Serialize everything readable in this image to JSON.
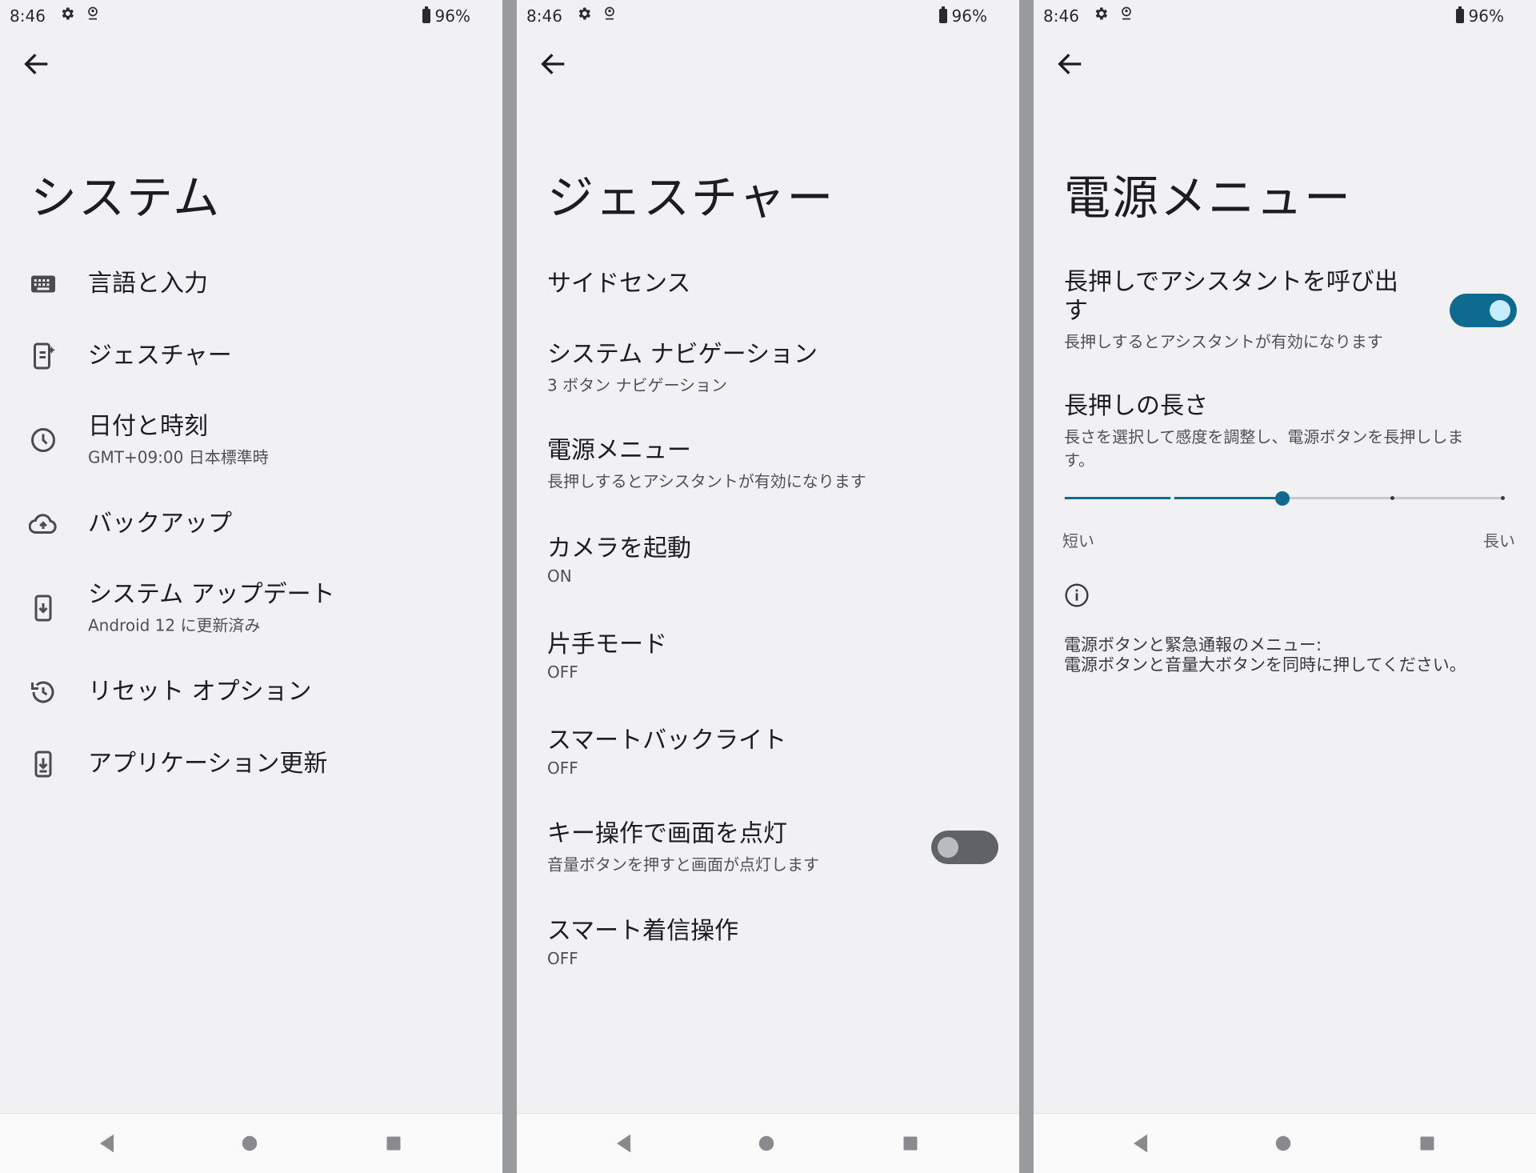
{
  "statusbar": {
    "time": "8:46",
    "battery": "96%"
  },
  "colors": {
    "accent": "#0f6a8f",
    "background": "#f1f0f3",
    "toggle_off": "#5f6266"
  },
  "screen1": {
    "title": "システム",
    "items": [
      {
        "icon": "keyboard-icon",
        "title": "言語と入力",
        "subtitle": ""
      },
      {
        "icon": "gesture-phone-icon",
        "title": "ジェスチャー",
        "subtitle": ""
      },
      {
        "icon": "clock-icon",
        "title": "日付と時刻",
        "subtitle": "GMT+09:00 日本標準時"
      },
      {
        "icon": "cloud-upload-icon",
        "title": "バックアップ",
        "subtitle": ""
      },
      {
        "icon": "system-update-icon",
        "title": "システム アップデート",
        "subtitle": "Android 12 に更新済み"
      },
      {
        "icon": "history-icon",
        "title": "リセット オプション",
        "subtitle": ""
      },
      {
        "icon": "app-update-icon",
        "title": "アプリケーション更新",
        "subtitle": ""
      }
    ]
  },
  "screen2": {
    "title": "ジェスチャー",
    "items": [
      {
        "title": "サイドセンス",
        "subtitle": ""
      },
      {
        "title": "システム ナビゲーション",
        "subtitle": "3 ボタン ナビゲーション"
      },
      {
        "title": "電源メニュー",
        "subtitle": "長押しするとアシスタントが有効になります"
      },
      {
        "title": "カメラを起動",
        "subtitle": "ON"
      },
      {
        "title": "片手モード",
        "subtitle": "OFF"
      },
      {
        "title": "スマートバックライト",
        "subtitle": "OFF"
      },
      {
        "title": "キー操作で画面を点灯",
        "subtitle": "音量ボタンを押すと画面が点灯します",
        "toggle": "off"
      },
      {
        "title": "スマート着信操作",
        "subtitle": "OFF"
      }
    ]
  },
  "screen3": {
    "title": "電源メニュー",
    "assistant": {
      "title_line1": "長押しでアシスタントを呼び出",
      "title_line2": "す",
      "subtitle": "長押しするとアシスタントが有効になります",
      "toggle": "on"
    },
    "press_length": {
      "title": "長押しの長さ",
      "subtitle_line1": "長さを選択して感度を調整し、電源ボタンを長押ししま",
      "subtitle_line2": "す。",
      "slider_steps": 5,
      "slider_value_index": 2,
      "label_min": "短い",
      "label_max": "長い"
    },
    "note_line1": "電源ボタンと緊急通報のメニュー:",
    "note_line2": "電源ボタンと音量大ボタンを同時に押してください。"
  }
}
